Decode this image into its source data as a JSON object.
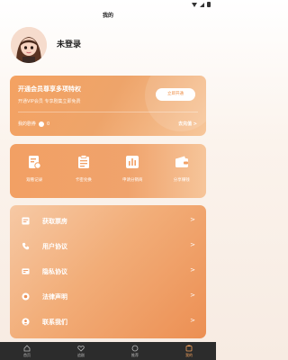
{
  "header": {
    "title": "我的"
  },
  "profile": {
    "username": "未登录"
  },
  "vip": {
    "title": "开通会员尊享多项特权",
    "subtitle": "开通VIP会员 专享剧集立即免费",
    "button_label": "立即开通",
    "balance_label": "我的剧券",
    "balance_value": "0",
    "recharge_label": "去充值 >"
  },
  "quick_actions": [
    {
      "label": "观看记录",
      "icon": "history-icon"
    },
    {
      "label": "卡密兑换",
      "icon": "redeem-icon"
    },
    {
      "label": "申请分销商",
      "icon": "distributor-icon"
    },
    {
      "label": "分享赚钱",
      "icon": "wallet-icon"
    }
  ],
  "menu": [
    {
      "label": "获取票房",
      "icon": "box-office-icon"
    },
    {
      "label": "用户协议",
      "icon": "phone-icon"
    },
    {
      "label": "隐私协议",
      "icon": "privacy-icon"
    },
    {
      "label": "法律声明",
      "icon": "legal-icon"
    },
    {
      "label": "联系我们",
      "icon": "contact-icon"
    }
  ],
  "menu_arrow": ">",
  "tabs": [
    {
      "label": "首页",
      "icon": "home-icon"
    },
    {
      "label": "追剧",
      "icon": "heart-icon"
    },
    {
      "label": "推荐",
      "icon": "recommend-icon"
    },
    {
      "label": "我的",
      "icon": "profile-icon",
      "active": true
    }
  ],
  "colors": {
    "accent": "#f3a15b",
    "tab_bar": "#2c2c2c"
  }
}
